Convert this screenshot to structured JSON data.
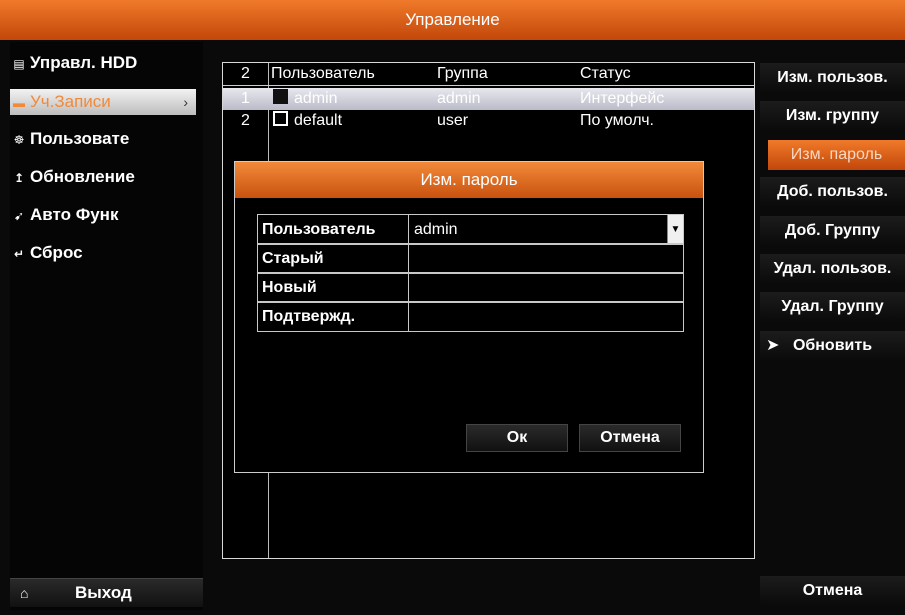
{
  "window": {
    "title": "Управление"
  },
  "sidebar": {
    "items": [
      {
        "label": "Управл. HDD",
        "icon": "hdd-icon",
        "glyph": "▤"
      },
      {
        "label": "Уч.Записи",
        "icon": "folder-icon",
        "glyph": "▬",
        "active": true,
        "chevron": "›"
      },
      {
        "label": "Пользовате",
        "icon": "users-icon",
        "glyph": "☸"
      },
      {
        "label": "Обновление",
        "icon": "upgrade-icon",
        "glyph": "↥"
      },
      {
        "label": "Авто Функ",
        "icon": "auto-function-icon",
        "glyph": "➹"
      },
      {
        "label": "Сброс",
        "icon": "reset-icon",
        "glyph": "↵"
      }
    ],
    "exit_label": "Выход",
    "exit_icon_glyph": "⌂"
  },
  "table": {
    "headers": {
      "num": "2",
      "user": "Пользователь",
      "group": "Группа",
      "status": "Статус"
    },
    "rows": [
      {
        "num": "1",
        "user": "admin",
        "group": "admin",
        "status": "Интерфейс",
        "selected": true
      },
      {
        "num": "2",
        "user": "default",
        "group": "user",
        "status": "По умолч.",
        "selected": false
      }
    ]
  },
  "actions": {
    "edit_user": "Изм. пользов.",
    "edit_group": "Изм. группу",
    "edit_password": "Изм. пароль",
    "add_user": "Доб. пользов.",
    "add_group": "Доб. Группу",
    "delete_user": "Удал. пользов.",
    "delete_group": "Удал. Группу",
    "refresh": "Обновить",
    "cancel": "Отмена"
  },
  "dialog": {
    "title": "Изм. пароль",
    "fields": {
      "user_label": "Пользователь",
      "user_value": "admin",
      "old_label": "Старый",
      "old_value": "",
      "new_label": "Новый",
      "new_value": "",
      "confirm_label": "Подтвержд.",
      "confirm_value": ""
    },
    "ok_label": "Ок",
    "cancel_label": "Отмена"
  },
  "colors": {
    "accent": "#e0601a",
    "selection": "#c9cad6",
    "background": "#000000"
  }
}
